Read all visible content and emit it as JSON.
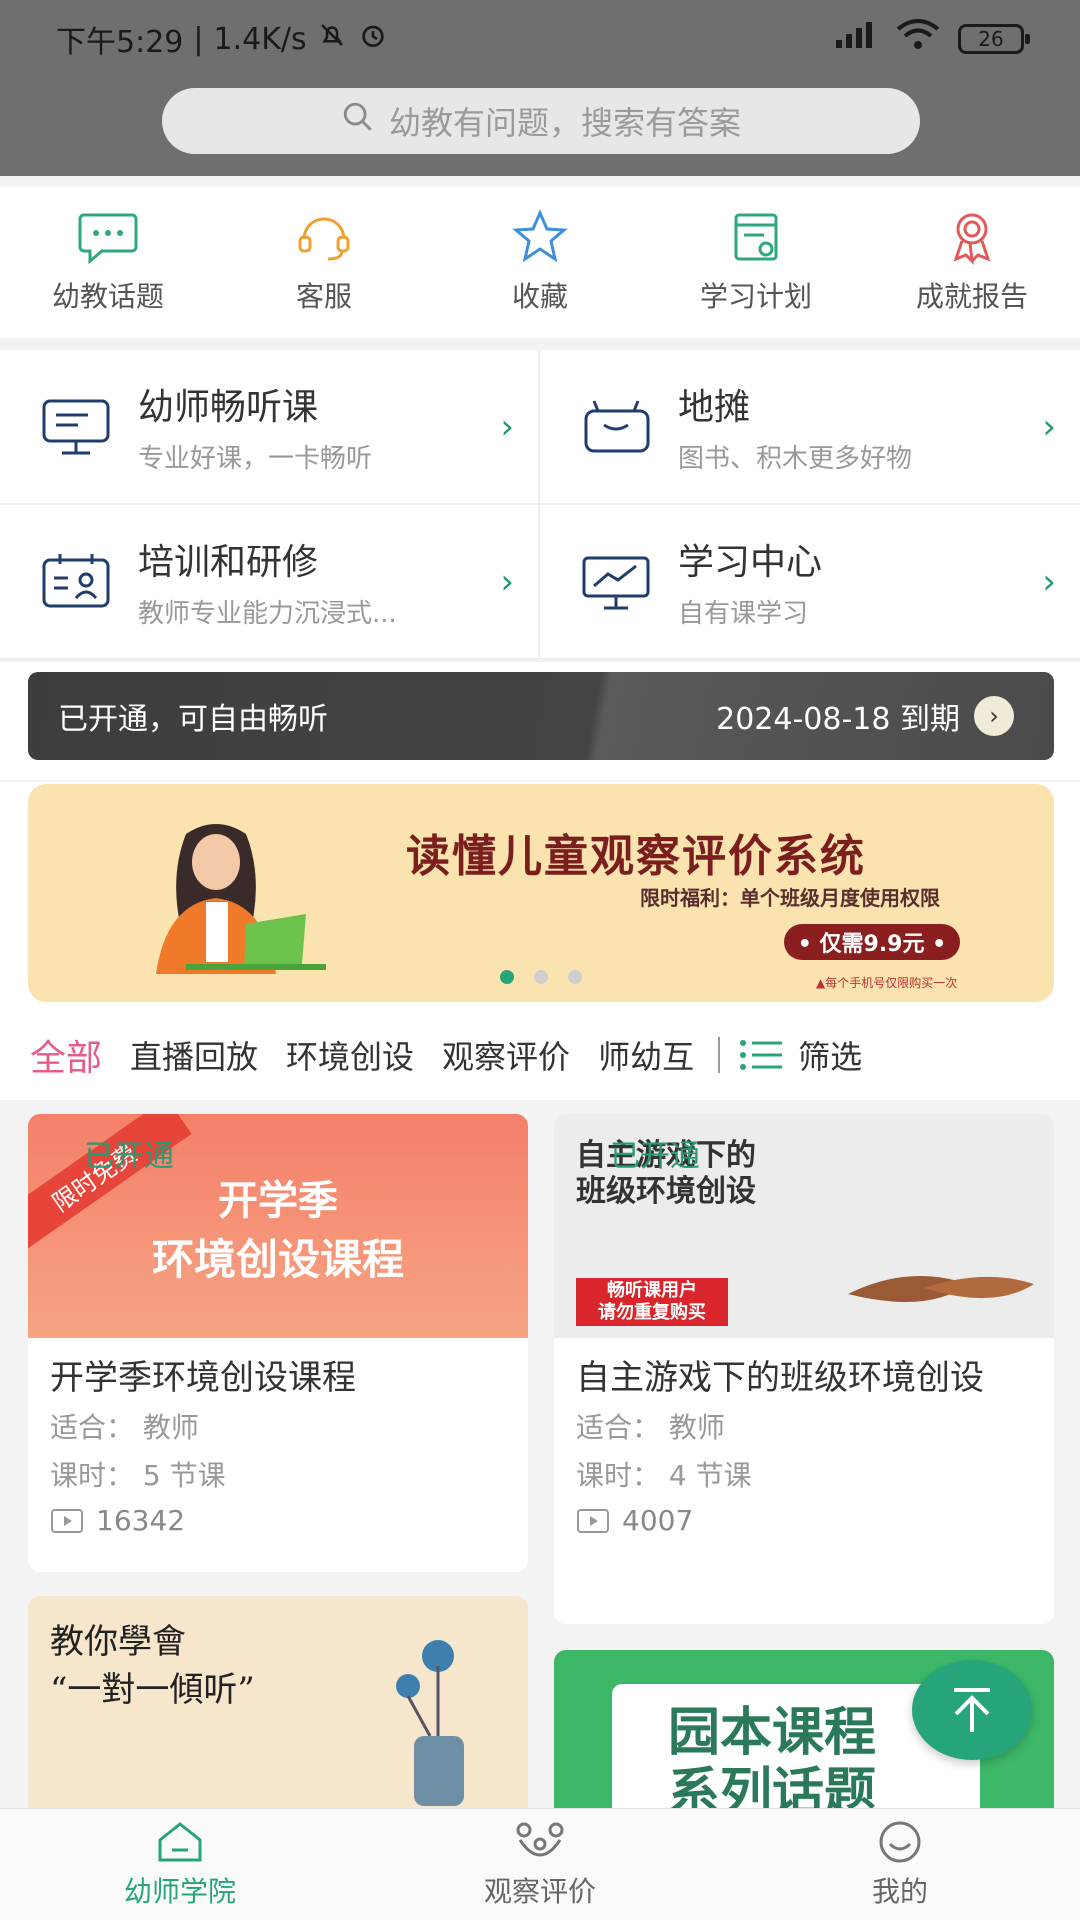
{
  "status_bar": {
    "time": "下午5:29",
    "speed": "1.4K/s",
    "battery": "26"
  },
  "search": {
    "placeholder": "幼教有问题，搜索有答案"
  },
  "quick": [
    {
      "label": "幼教话题",
      "icon": "chat-icon"
    },
    {
      "label": "客服",
      "icon": "headset-icon"
    },
    {
      "label": "收藏",
      "icon": "star-icon"
    },
    {
      "label": "学习计划",
      "icon": "calendar-icon"
    },
    {
      "label": "成就报告",
      "icon": "medal-icon"
    }
  ],
  "features": [
    {
      "title": "幼师畅听课",
      "subtitle": "专业好课，一卡畅听",
      "icon": "board-icon"
    },
    {
      "title": "地摊",
      "subtitle": "图书、积木更多好物",
      "icon": "bag-icon"
    },
    {
      "title": "培训和研修",
      "subtitle": "教师专业能力沉浸式...",
      "icon": "training-icon"
    },
    {
      "title": "学习中心",
      "subtitle": "自有课学习",
      "icon": "chart-board-icon"
    }
  ],
  "vip": {
    "left": "已开通，可自由畅听",
    "expire": "2024-08-18 到期"
  },
  "banner": {
    "title": "读懂儿童观察评价系统",
    "subtitle": "限时福利：单个班级月度使用权限",
    "price": "• 仅需9.9元 •",
    "note": "▲每个手机号仅限购买一次"
  },
  "tabs": [
    "全部",
    "直播回放",
    "环境创设",
    "观察评价",
    "师幼互"
  ],
  "filter_label": "筛选",
  "courses": [
    {
      "banner_tag": "限时免费",
      "banner_line1": "开学季",
      "banner_line2": "环境创设课程",
      "title": "开学季环境创设课程",
      "audience": "适合： 教师",
      "lessons": "课时： 5 节课",
      "views": "16342",
      "status": "已开通"
    },
    {
      "banner_line1": "自主游戏下的",
      "banner_line2": "班级环境创设",
      "banner_stamp1": "畅听课用户",
      "banner_stamp2": "请勿重复购买",
      "title": "自主游戏下的班级环境创设",
      "audience": "适合： 教师",
      "lessons": "课时： 4 节课",
      "views": "4007",
      "status": "已开通"
    },
    {
      "banner_line1": "教你學會",
      "banner_line2": "“一對一傾听”"
    },
    {
      "banner_line1": "园本课程",
      "banner_line2": "系列话题"
    }
  ],
  "nav": [
    {
      "label": "幼师学院",
      "icon": "home-icon",
      "active": true
    },
    {
      "label": "观察评价",
      "icon": "observe-icon"
    },
    {
      "label": "我的",
      "icon": "smile-icon"
    }
  ],
  "colors": {
    "accent": "#27a57a",
    "tab_active": "#e85a89",
    "header": "#6f6f6f"
  }
}
